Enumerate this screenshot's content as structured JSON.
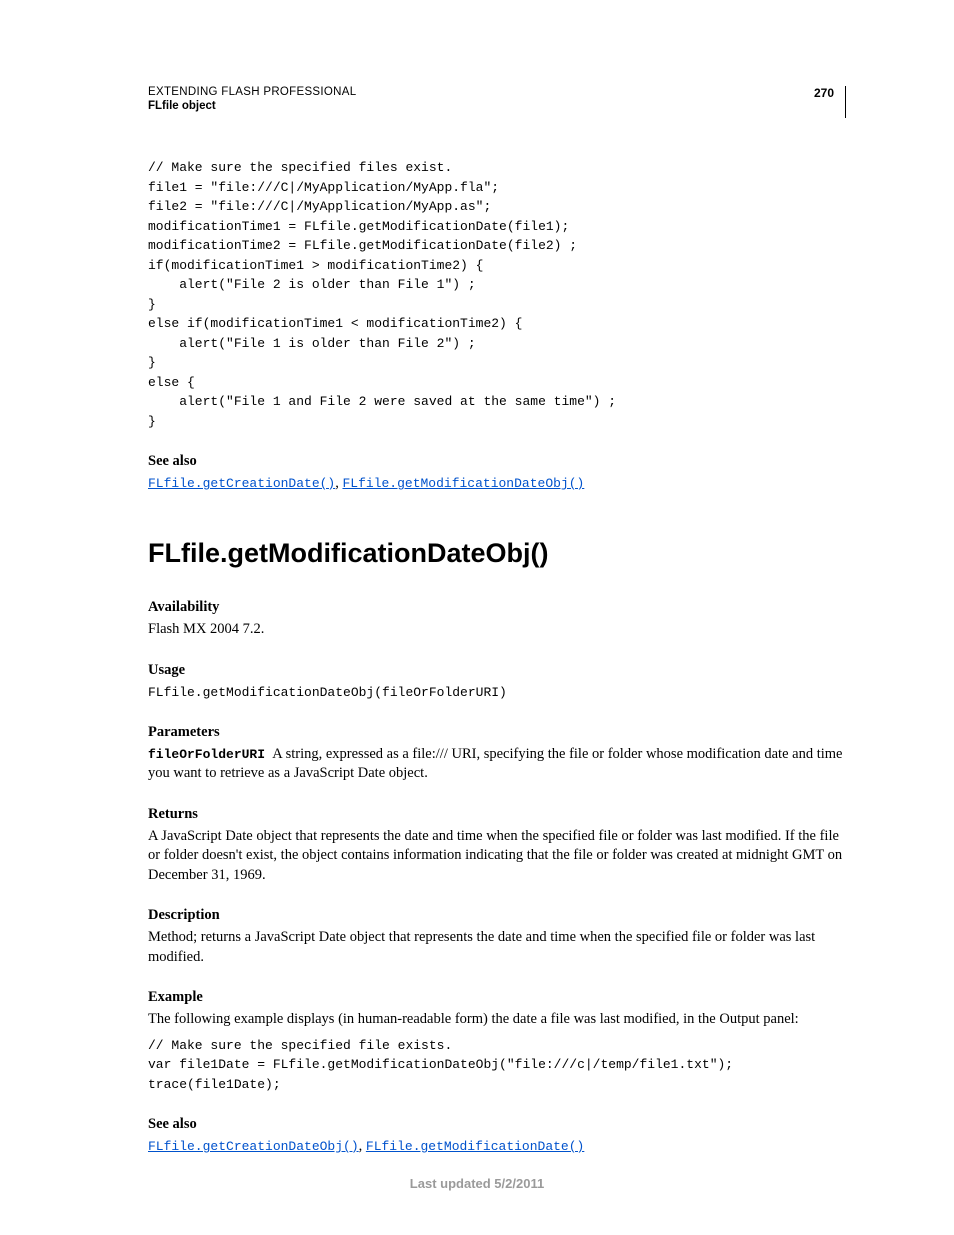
{
  "header": {
    "doc_title": "EXTENDING FLASH PROFESSIONAL",
    "section_sub": "FLfile object",
    "page_number": "270"
  },
  "code1": "// Make sure the specified files exist.\nfile1 = \"file:///C|/MyApplication/MyApp.fla\";\nfile2 = \"file:///C|/MyApplication/MyApp.as\";\nmodificationTime1 = FLfile.getModificationDate(file1);\nmodificationTime2 = FLfile.getModificationDate(file2) ;\nif(modificationTime1 > modificationTime2) {\n    alert(\"File 2 is older than File 1\") ;\n}\nelse if(modificationTime1 < modificationTime2) {\n    alert(\"File 1 is older than File 2\") ;\n}\nelse {\n    alert(\"File 1 and File 2 were saved at the same time\") ;\n}",
  "see_also_1": {
    "heading": "See also",
    "link1": "FLfile.getCreationDate()",
    "link2": "FLfile.getModificationDateObj()"
  },
  "api_title": "FLfile.getModificationDateObj()",
  "availability": {
    "heading": "Availability",
    "text": "Flash MX 2004 7.2."
  },
  "usage": {
    "heading": "Usage",
    "code": "FLfile.getModificationDateObj(fileOrFolderURI)"
  },
  "parameters": {
    "heading": "Parameters",
    "param_name": "fileOrFolderURI",
    "text": "A string, expressed as a file:/// URI, specifying the file or folder whose modification date and time you want to retrieve as a JavaScript Date object."
  },
  "returns": {
    "heading": "Returns",
    "text": "A JavaScript Date object that represents the date and time when the specified file or folder was last modified. If the file or folder doesn't exist, the object contains information indicating that the file or folder was created at midnight GMT on December 31, 1969."
  },
  "description": {
    "heading": "Description",
    "text": "Method; returns a JavaScript Date object that represents the date and time when the specified file or folder was last modified."
  },
  "example": {
    "heading": "Example",
    "intro": "The following example displays (in human-readable form) the date a file was last modified, in the Output panel:",
    "code": "// Make sure the specified file exists.\nvar file1Date = FLfile.getModificationDateObj(\"file:///c|/temp/file1.txt\");\ntrace(file1Date);"
  },
  "see_also_2": {
    "heading": "See also",
    "link1": "FLfile.getCreationDateObj()",
    "link2": "FLfile.getModificationDate()"
  },
  "footer": "Last updated 5/2/2011"
}
